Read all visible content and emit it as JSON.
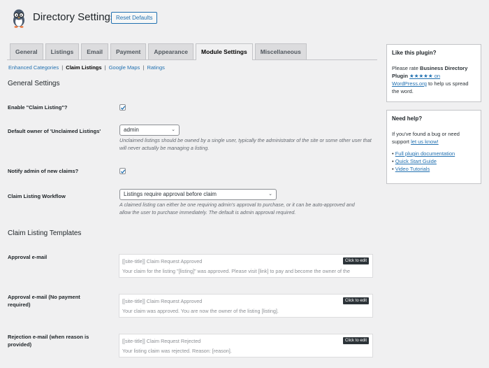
{
  "header": {
    "title": "Directory Settings",
    "reset_button": "Reset Defaults",
    "logo_icon": "penguin-mascot-icon"
  },
  "tabs": [
    {
      "label": "General",
      "active": false
    },
    {
      "label": "Listings",
      "active": false
    },
    {
      "label": "Email",
      "active": false
    },
    {
      "label": "Payment",
      "active": false
    },
    {
      "label": "Appearance",
      "active": false
    },
    {
      "label": "Module Settings",
      "active": true
    },
    {
      "label": "Miscellaneous",
      "active": false
    }
  ],
  "subnav": {
    "items": [
      {
        "label": "Enhanced Categories",
        "current": false
      },
      {
        "label": "Claim Listings",
        "current": true
      },
      {
        "label": "Google Maps",
        "current": false
      },
      {
        "label": "Ratings",
        "current": false
      }
    ],
    "separator": "|"
  },
  "general": {
    "title": "General Settings",
    "enable_claim": {
      "label": "Enable \"Claim Listing\"?",
      "checked": true
    },
    "default_owner": {
      "label": "Default owner of 'Unclaimed Listings'",
      "value": "admin",
      "description": "Unclaimed listings should be owned by a single user, typically the administrator of the site or some other user that will never actually be managing a listing."
    },
    "notify_admin": {
      "label": "Notify admin of new claims?",
      "checked": true
    },
    "workflow": {
      "label": "Claim Listing Workflow",
      "value": "Listings require approval before claim",
      "description": "A claimed listing can either be one requiring admin's approval to purchase, or it can be auto-approved and allow the user to purchase immediately. The default is admin approval required."
    }
  },
  "templates": {
    "title": "Claim Listing Templates",
    "edit_label": "Click to edit",
    "items": [
      {
        "label": "Approval e-mail",
        "subject": "[[site-title]] Claim Request Approved",
        "body": "Your claim for the listing \"[listing]\" was approved. Please visit [link] to pay and become the owner of the"
      },
      {
        "label": "Approval e-mail (No payment required)",
        "subject": "[[site-title]] Claim Request Approved",
        "body": "Your claim was approved. You are now the owner of the listing [listing]."
      },
      {
        "label": "Rejection e-mail (when reason is provided)",
        "subject": "[[site-title]] Claim Request Rejected",
        "body": "Your listing claim was rejected. Reason: [reason]."
      }
    ]
  },
  "sidebar": {
    "rate": {
      "title": "Like this plugin?",
      "text_before": "Please rate ",
      "plugin_name": "Business Directory Plugin",
      "link_text": "★★★★★ on WordPress.org",
      "text_after": " to help us spread the word."
    },
    "help": {
      "title": "Need help?",
      "text": "If you've found a bug or need support ",
      "link_text": "let us know!",
      "links": [
        "Full plugin documentation",
        "Quick Start Guide",
        "Video Tutorials"
      ]
    }
  },
  "colors": {
    "accent": "#2271b1",
    "background": "#f0f0f1",
    "edit_button": "#2c3338"
  }
}
